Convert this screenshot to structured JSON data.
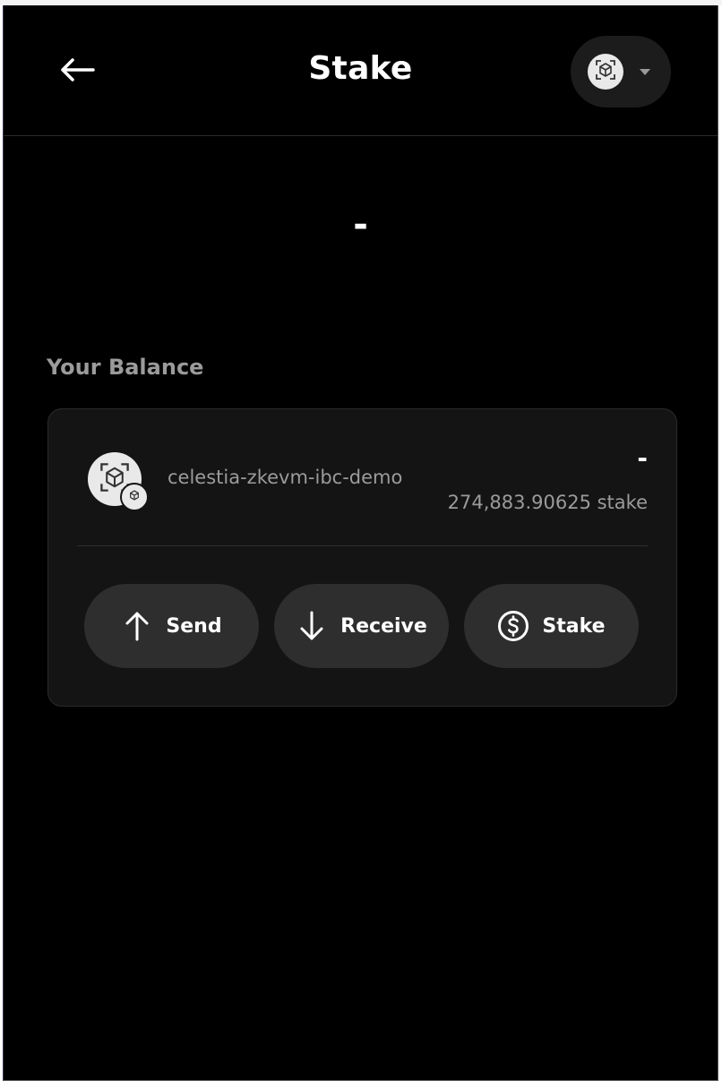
{
  "header": {
    "title": "Stake",
    "back_icon": "arrow-left-icon",
    "chain_icon": "cube-icon",
    "chain_caret_icon": "caret-down-icon"
  },
  "summary": {
    "fiat_total": "-"
  },
  "balance_section": {
    "label": "Your Balance"
  },
  "asset": {
    "name": "celestia-zkevm-ibc-demo",
    "fiat_value": "-",
    "amount": "274,883.90625 stake",
    "icon": "cube-icon"
  },
  "actions": [
    {
      "label": "Send",
      "icon": "arrow-up-icon"
    },
    {
      "label": "Receive",
      "icon": "arrow-down-icon"
    },
    {
      "label": "Stake",
      "icon": "dollar-circle-icon"
    }
  ],
  "colors": {
    "background": "#000000",
    "card": "#141414",
    "button": "#2e2e2e",
    "muted_text": "#9b9b9b"
  }
}
